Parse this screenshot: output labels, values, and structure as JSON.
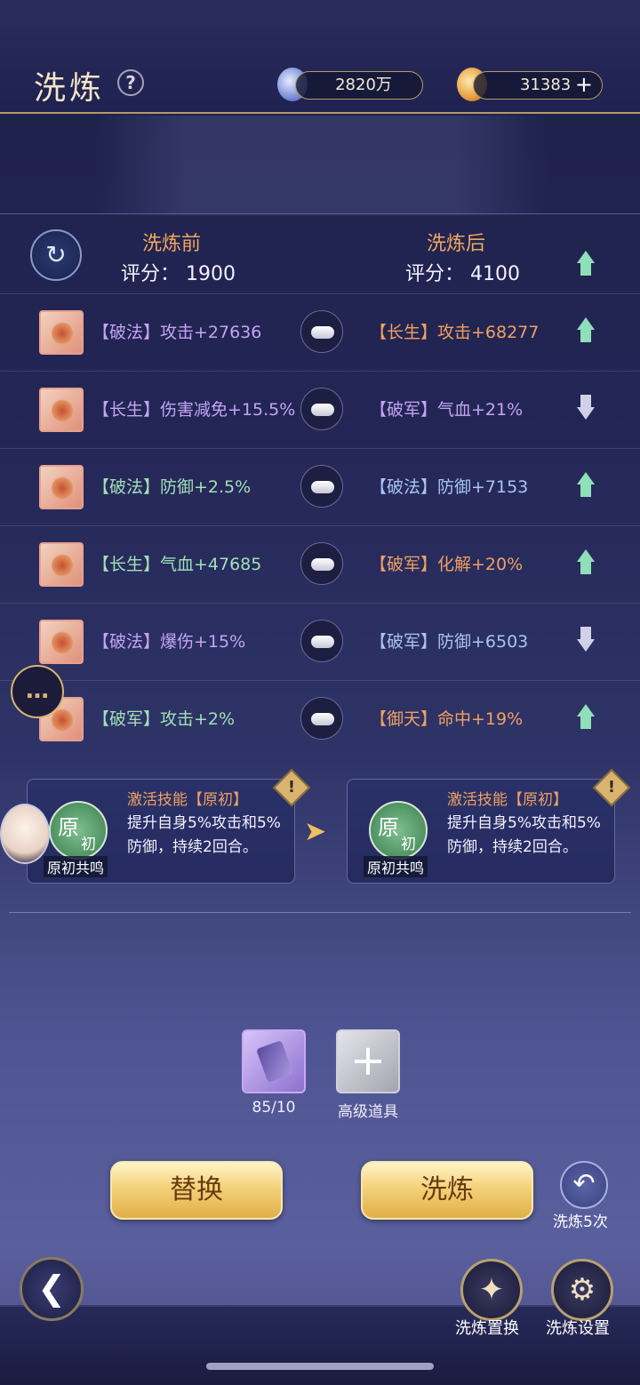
{
  "header": {
    "title": "洗炼",
    "help_icon": "question-icon",
    "resource1": {
      "icon": "spirit-gem-icon",
      "value": "2820万"
    },
    "resource2": {
      "icon": "flame-gem-icon",
      "value": "31383",
      "add": "+"
    }
  },
  "compare": {
    "before_label": "洗炼前",
    "after_label": "洗炼后",
    "before_score": "评分：  1900",
    "after_score": "评分：  4100",
    "trend": "up"
  },
  "rows": [
    {
      "left": "【破法】攻击+27636",
      "right": "【长生】攻击+68277",
      "left_color": "#c4a4f4",
      "right_color": "#f0a060",
      "trend": "up"
    },
    {
      "left": "【长生】伤害减免+15.5%",
      "right": "【破军】气血+21%",
      "left_color": "#c4a4f4",
      "right_color": "#c4a4f4",
      "trend": "down"
    },
    {
      "left": "【破法】防御+2.5%",
      "right": "【破法】防御+7153",
      "left_color": "#a0e0b8",
      "right_color": "#a8c4f4",
      "trend": "up"
    },
    {
      "left": "【长生】气血+47685",
      "right": "【破军】化解+20%",
      "left_color": "#a0e0b8",
      "right_color": "#f0a060",
      "trend": "up"
    },
    {
      "left": "【破法】爆伤+15%",
      "right": "【破军】防御+6503",
      "left_color": "#c4a4f4",
      "right_color": "#a8c4f4",
      "trend": "down"
    },
    {
      "left": "【破军】攻击+2%",
      "right": "【御天】命中+19%",
      "left_color": "#a0e0b8",
      "right_color": "#f0a060",
      "trend": "up"
    }
  ],
  "skill_before": {
    "title": "激活技能【原初】",
    "badge_big": "原",
    "badge_small": "初",
    "badge_label": "原初共鸣",
    "desc": "提升自身5%攻击和5%防御，持续2回合。",
    "warn": "!"
  },
  "skill_after": {
    "title": "激活技能【原初】",
    "badge_big": "原",
    "badge_small": "初",
    "badge_label": "原初共鸣",
    "desc": "提升自身5%攻击和5%防御，持续2回合。",
    "warn": "!"
  },
  "items": {
    "crystal_count": "85/10",
    "add_label": "高级道具"
  },
  "buttons": {
    "replace": "替换",
    "refine": "洗炼",
    "refine5": "洗炼5次",
    "swap": "洗炼置换",
    "settings": "洗炼设置"
  }
}
